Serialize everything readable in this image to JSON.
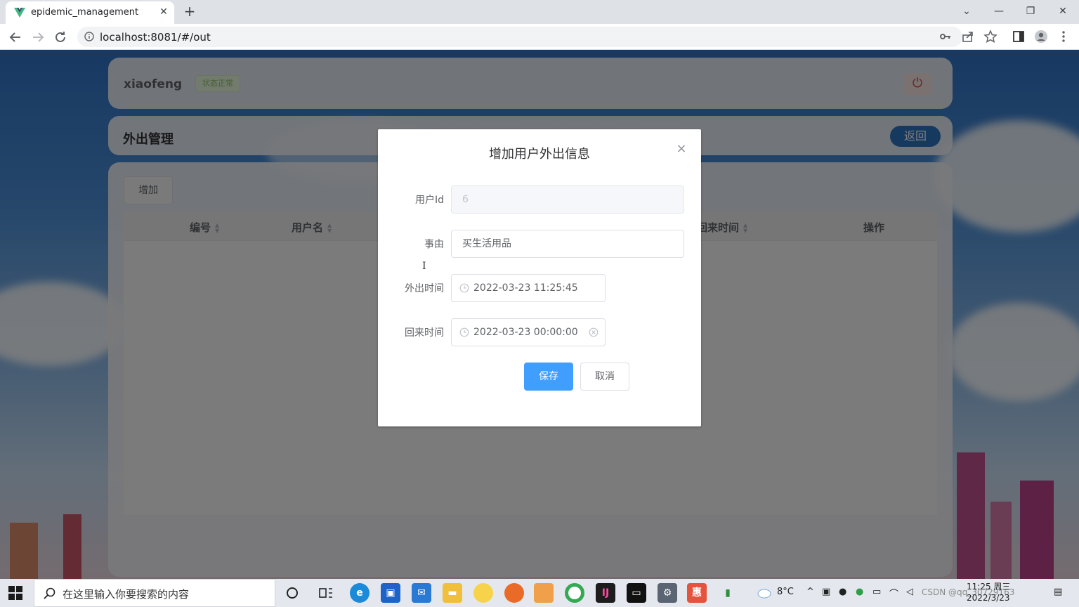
{
  "browser": {
    "tab_title": "epidemic_management",
    "tab_close": "✕",
    "new_tab": "+",
    "url": "localhost:8081/#/out",
    "win_minimize": "—",
    "win_restore": "❐",
    "win_close": "✕",
    "tab_list": "⌄"
  },
  "header": {
    "username": "xiaofeng",
    "status_tag": "状态正常",
    "power_icon": "⏻"
  },
  "section": {
    "title": "外出管理",
    "back_label": "返回"
  },
  "table": {
    "add_label": "增加",
    "columns": [
      "编号",
      "用户名",
      "回来时间",
      "操作"
    ]
  },
  "dialog": {
    "title": "增加用户外出信息",
    "close": "×",
    "fields": {
      "user_id": {
        "label": "用户Id",
        "value": "6"
      },
      "reason": {
        "label": "事由",
        "value": "买生活用品"
      },
      "out_time": {
        "label": "外出时间",
        "value": "2022-03-23 11:25:45"
      },
      "return_time": {
        "label": "回来时间",
        "value": "2022-03-23 00:00:00"
      }
    },
    "save_label": "保存",
    "cancel_label": "取消"
  },
  "taskbar": {
    "search_placeholder": "在这里输入你要搜索的内容",
    "weather": "8°C",
    "time": "11:25 周三",
    "date": "2022/3/23",
    "watermark": "CSDN @qq_30729163"
  },
  "colors": {
    "primary": "#409eff",
    "back_button": "#2c73bf",
    "status_green": "#8bc16a",
    "power_red": "#d64545"
  }
}
